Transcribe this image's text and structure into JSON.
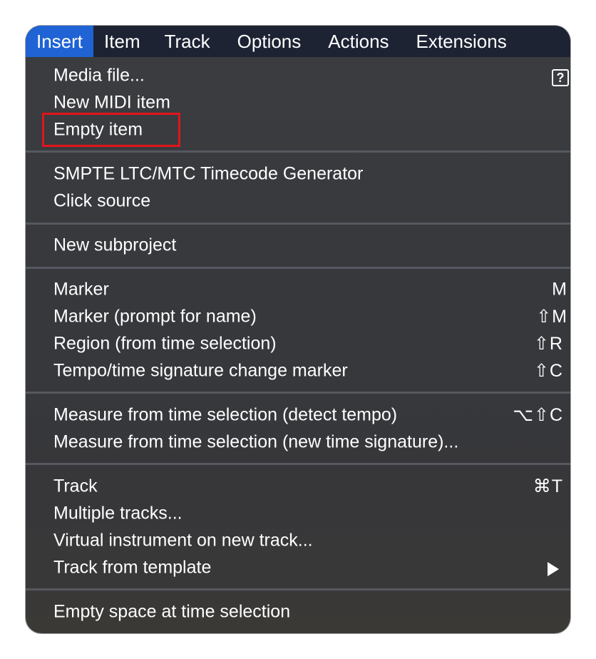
{
  "menubar": {
    "items": [
      "Insert",
      "Item",
      "Track",
      "Options",
      "Actions",
      "Extensions"
    ],
    "active": "Insert",
    "active_color": "#1f63d4"
  },
  "menu": {
    "groups": [
      [
        {
          "label": "Media file...",
          "shortcut": ""
        },
        {
          "label": "New MIDI item",
          "shortcut": ""
        },
        {
          "label": "Empty item",
          "shortcut": ""
        }
      ],
      [
        {
          "label": "SMPTE LTC/MTC Timecode Generator",
          "shortcut": ""
        },
        {
          "label": "Click source",
          "shortcut": ""
        }
      ],
      [
        {
          "label": "New subproject",
          "shortcut": ""
        }
      ],
      [
        {
          "label": "Marker",
          "shortcut": "M"
        },
        {
          "label": "Marker (prompt for name)",
          "shortcut": "⇧M"
        },
        {
          "label": "Region (from time selection)",
          "shortcut": "⇧R"
        },
        {
          "label": "Tempo/time signature change marker",
          "shortcut": "⇧C"
        }
      ],
      [
        {
          "label": "Measure from time selection (detect tempo)",
          "shortcut": "⌥⇧C"
        },
        {
          "label": "Measure from time selection (new time signature)...",
          "shortcut": ""
        }
      ],
      [
        {
          "label": "Track",
          "shortcut": "⌘T"
        },
        {
          "label": "Multiple tracks...",
          "shortcut": ""
        },
        {
          "label": "Virtual instrument on new track...",
          "shortcut": ""
        },
        {
          "label": "Track from template",
          "shortcut": ""
        }
      ],
      [
        {
          "label": "Empty space at time selection",
          "shortcut": ""
        }
      ]
    ],
    "help_icon": "help-icon",
    "submenu_icon": "submenu-arrow-icon",
    "highlight_color": "#e1141c"
  }
}
